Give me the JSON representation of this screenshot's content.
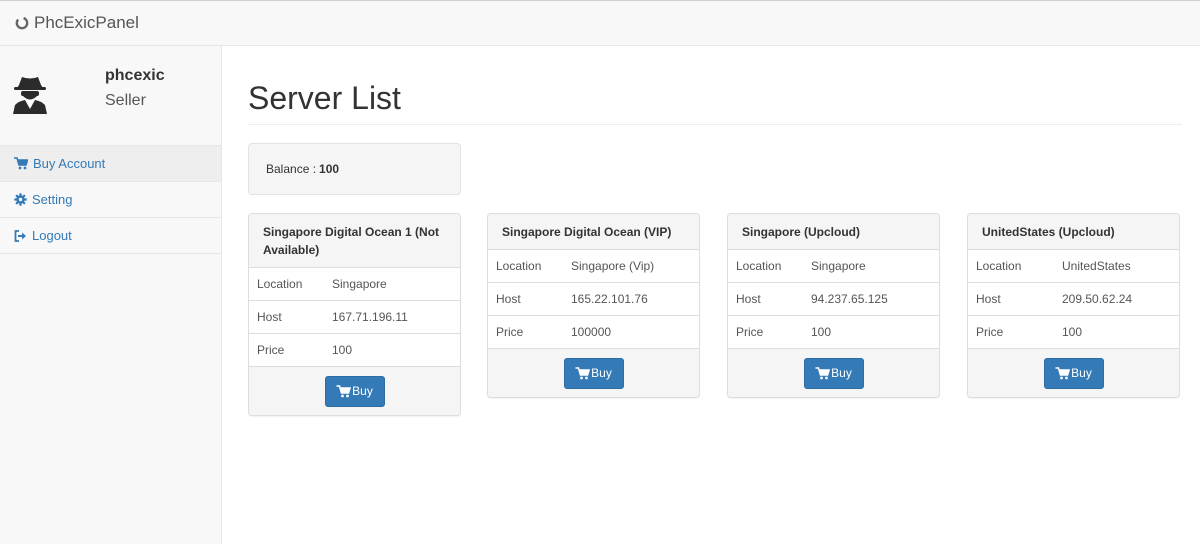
{
  "app": {
    "brand": "PhcExicPanel"
  },
  "user": {
    "name": "phcexic",
    "role": "Seller"
  },
  "sidebar": {
    "items": [
      {
        "label": "Buy Account",
        "icon": "cart-icon",
        "active": true
      },
      {
        "label": "Setting",
        "icon": "gear-icon",
        "active": false
      },
      {
        "label": "Logout",
        "icon": "logout-icon",
        "active": false
      }
    ]
  },
  "main": {
    "title": "Server List",
    "balance_label": "Balance :",
    "balance_value": "100"
  },
  "servers": [
    {
      "name": "Singapore Digital Ocean 1 (Not Available)",
      "location": "Singapore",
      "host": "167.71.196.11",
      "price": "100"
    },
    {
      "name": "Singapore Digital Ocean (VIP)",
      "location": "Singapore (Vip)",
      "host": "165.22.101.76",
      "price": "100000"
    },
    {
      "name": "Singapore (Upcloud)",
      "location": "Singapore",
      "host": "94.237.65.125",
      "price": "100"
    },
    {
      "name": "UnitedStates (Upcloud)",
      "location": "UnitedStates",
      "host": "209.50.62.24",
      "price": "100"
    }
  ],
  "labels": {
    "location": "Location",
    "host": "Host",
    "price": "Price",
    "buy": "Buy"
  },
  "colors": {
    "accent": "#337ab7",
    "navbar_bg": "#f8f8f8"
  }
}
